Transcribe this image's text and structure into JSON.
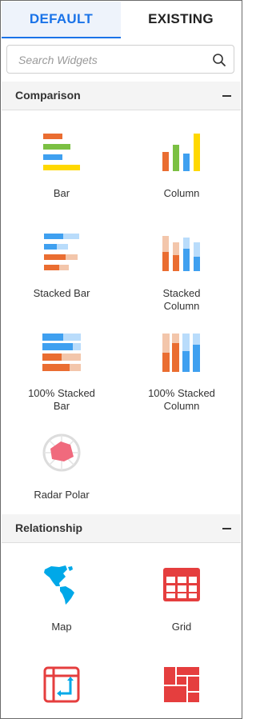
{
  "tabs": {
    "default": "DEFAULT",
    "existing": "EXISTING"
  },
  "search": {
    "placeholder": "Search Widgets",
    "icon": "search-icon"
  },
  "sections": {
    "comparison": {
      "title": "Comparison",
      "collapse_icon": "minus-icon",
      "widgets": [
        {
          "label": "Bar",
          "icon": "bar-chart-icon"
        },
        {
          "label": "Column",
          "icon": "column-chart-icon"
        },
        {
          "label": "Stacked Bar",
          "icon": "stacked-bar-icon"
        },
        {
          "label": "Stacked\nColumn",
          "icon": "stacked-column-icon"
        },
        {
          "label": "100% Stacked\nBar",
          "icon": "100-stacked-bar-icon"
        },
        {
          "label": "100% Stacked\nColumn",
          "icon": "100-stacked-column-icon"
        },
        {
          "label": "Radar Polar",
          "icon": "radar-polar-icon"
        }
      ]
    },
    "relationship": {
      "title": "Relationship",
      "collapse_icon": "minus-icon",
      "widgets": [
        {
          "label": "Map",
          "icon": "map-icon"
        },
        {
          "label": "Grid",
          "icon": "grid-icon"
        },
        {
          "label": "",
          "icon": "pivot-grid-icon"
        },
        {
          "label": "",
          "icon": "treemap-icon"
        }
      ]
    }
  },
  "colors": {
    "accent": "#1a73e8",
    "orange": "#ea6d31",
    "green": "#7bc043",
    "blue": "#3fa0f0",
    "yellow": "#ffd800",
    "light_orange": "#f3c6ab",
    "light_blue": "#b9dcfb",
    "red": "#e53e3e",
    "cyan": "#00a8e8"
  }
}
